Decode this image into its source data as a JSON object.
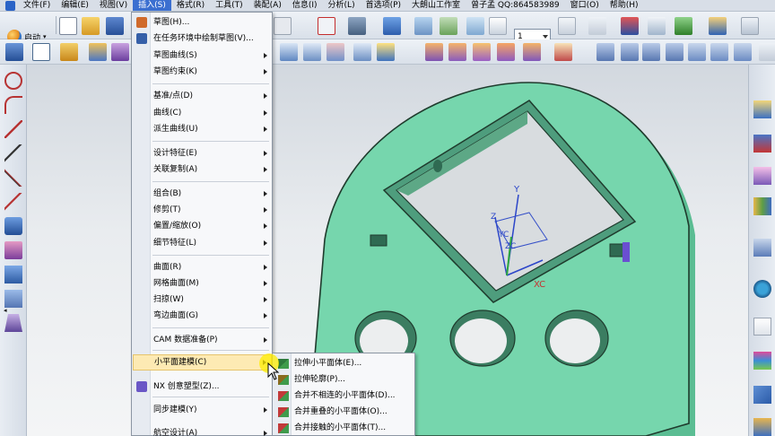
{
  "menubar": {
    "items": [
      {
        "label": "文件(F)"
      },
      {
        "label": "编辑(E)"
      },
      {
        "label": "视图(V)"
      },
      {
        "label": "插入(S)",
        "active": true
      },
      {
        "label": "格式(R)"
      },
      {
        "label": "工具(T)"
      },
      {
        "label": "装配(A)"
      },
      {
        "label": "信息(I)"
      },
      {
        "label": "分析(L)"
      },
      {
        "label": "首选项(P)"
      },
      {
        "label": "大朗山工作室"
      },
      {
        "label": "曾子孟 QQ:864583989"
      },
      {
        "label": "窗口(O)"
      },
      {
        "label": "帮助(H)"
      }
    ]
  },
  "toolbar": {
    "start_label": "启动",
    "layer_value": "1"
  },
  "insert_menu": {
    "items": [
      {
        "label": "草图(H)...",
        "submenu": false,
        "icon": "sketch-icon"
      },
      {
        "label": "在任务环境中绘制草图(V)...",
        "submenu": false,
        "icon": "sketch-task-icon"
      },
      {
        "label": "草图曲线(S)",
        "submenu": true
      },
      {
        "label": "草图约束(K)",
        "submenu": true
      },
      {
        "label": "基准/点(D)",
        "submenu": true
      },
      {
        "label": "曲线(C)",
        "submenu": true
      },
      {
        "label": "派生曲线(U)",
        "submenu": true
      },
      {
        "label": "设计特征(E)",
        "submenu": true
      },
      {
        "label": "关联复制(A)",
        "submenu": true
      },
      {
        "label": "组合(B)",
        "submenu": true
      },
      {
        "label": "修剪(T)",
        "submenu": true
      },
      {
        "label": "偏置/缩放(O)",
        "submenu": true
      },
      {
        "label": "细节特征(L)",
        "submenu": true
      },
      {
        "label": "曲面(R)",
        "submenu": true
      },
      {
        "label": "网格曲面(M)",
        "submenu": true
      },
      {
        "label": "扫掠(W)",
        "submenu": true
      },
      {
        "label": "弯边曲面(G)",
        "submenu": true
      },
      {
        "label": "CAM 数据准备(P)",
        "submenu": true
      },
      {
        "label": "小平面建模(C)",
        "submenu": true,
        "highlighted": true
      },
      {
        "label": "NX 创意塑型(Z)...",
        "submenu": false,
        "icon": "nx-realize-shape-icon"
      },
      {
        "label": "同步建模(Y)",
        "submenu": true
      },
      {
        "label": "航空设计(A)",
        "submenu": true
      }
    ]
  },
  "facet_submenu": {
    "items": [
      {
        "label": "拉伸小平面体(E)...",
        "icon": "extrude-facet-icon"
      },
      {
        "label": "拉伸轮廓(P)...",
        "icon": "extrude-profile-icon"
      },
      {
        "label": "合并不相连的小平面体(D)...",
        "icon": "merge-disjoint-icon"
      },
      {
        "label": "合并重叠的小平面体(O)...",
        "icon": "merge-overlap-icon"
      },
      {
        "label": "合并接触的小平面体(T)...",
        "icon": "merge-touch-icon"
      }
    ]
  },
  "viewport": {
    "axis_labels": {
      "x": "XC",
      "y": "Y",
      "z": "Z",
      "yc": "YC",
      "zc": "ZC"
    }
  },
  "colors": {
    "part_face": "#76d6ad",
    "part_edge": "#1f3b2d",
    "menu_highlight": "#fdeab3",
    "menubar_active": "#3b6fd0"
  }
}
